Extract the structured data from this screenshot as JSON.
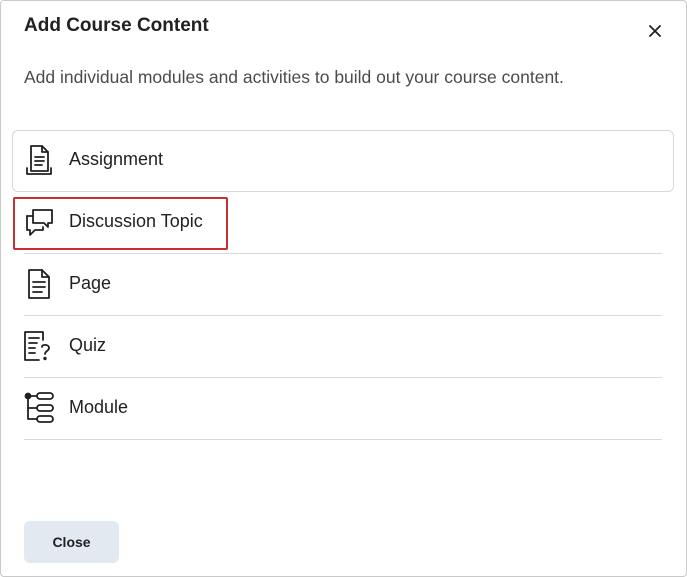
{
  "dialog": {
    "title": "Add Course Content",
    "description": "Add individual modules and activities to build out your course content.",
    "close_icon": "close-x-icon",
    "close_button_label": "Close"
  },
  "content_types": [
    {
      "label": "Assignment",
      "icon": "assignment-icon",
      "state": "hovered"
    },
    {
      "label": "Discussion Topic",
      "icon": "discussion-icon",
      "state": "selected"
    },
    {
      "label": "Page",
      "icon": "page-icon",
      "state": "default"
    },
    {
      "label": "Quiz",
      "icon": "quiz-icon",
      "state": "default"
    },
    {
      "label": "Module",
      "icon": "module-icon",
      "state": "default"
    }
  ],
  "colors": {
    "highlight_border": "#c62f33",
    "divider": "#d3d9e3",
    "button_background": "#e3e9f1",
    "text": "#202122"
  }
}
